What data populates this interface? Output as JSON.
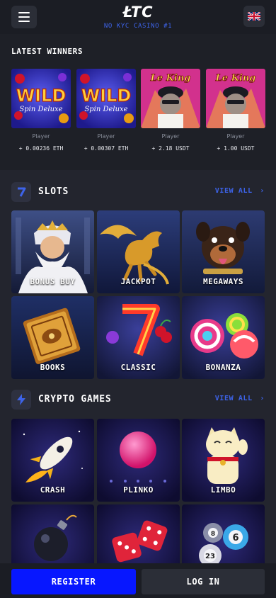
{
  "header": {
    "logo": "ŁTC",
    "tagline": "NO KYC CASINO #1",
    "menu_icon": "hamburger-menu-icon",
    "language_icon": "uk-flag-icon"
  },
  "latest_winners": {
    "title": "LATEST WINNERS",
    "items": [
      {
        "game_art": "Wild Spin Deluxe",
        "player": "Player",
        "amount": "+ 0.00236 ETH"
      },
      {
        "game_art": "Wild Spin Deluxe",
        "player": "Player",
        "amount": "+ 0.00307 ETH"
      },
      {
        "game_art": "Le King",
        "player": "Player",
        "amount": "+ 2.18 USDT"
      },
      {
        "game_art": "Le King",
        "player": "Player",
        "amount": "+ 1.00 USDT"
      }
    ]
  },
  "slots": {
    "title": "SLOTS",
    "icon": "seven-icon",
    "view_all": "VIEW ALL",
    "tiles": [
      {
        "label": "BONUS BUY",
        "icon": "zeus-icon"
      },
      {
        "label": "JACKPOT",
        "icon": "pegasus-icon"
      },
      {
        "label": "MEGAWAYS",
        "icon": "dog-icon"
      },
      {
        "label": "BOOKS",
        "icon": "book-icon"
      },
      {
        "label": "CLASSIC",
        "icon": "lucky-seven-icon"
      },
      {
        "label": "BONANZA",
        "icon": "candy-icon"
      }
    ]
  },
  "crypto_games": {
    "title": "CRYPTO GAMES",
    "icon": "lightning-icon",
    "view_all": "VIEW ALL",
    "tiles": [
      {
        "label": "CRASH",
        "icon": "rocket-icon"
      },
      {
        "label": "PLINKO",
        "icon": "plinko-ball-icon"
      },
      {
        "label": "LIMBO",
        "icon": "lucky-cat-icon"
      },
      {
        "label": "",
        "icon": "bomb-icon"
      },
      {
        "label": "",
        "icon": "dice-icon"
      },
      {
        "label": "",
        "icon": "lottery-balls-icon"
      }
    ]
  },
  "lottery_ball_numbers": [
    "8",
    "6",
    "23"
  ],
  "footer": {
    "register": "REGISTER",
    "login": "LOG IN"
  },
  "colors": {
    "accent": "#3d63e8",
    "register_button": "#0717ff",
    "background": "#23252e"
  }
}
